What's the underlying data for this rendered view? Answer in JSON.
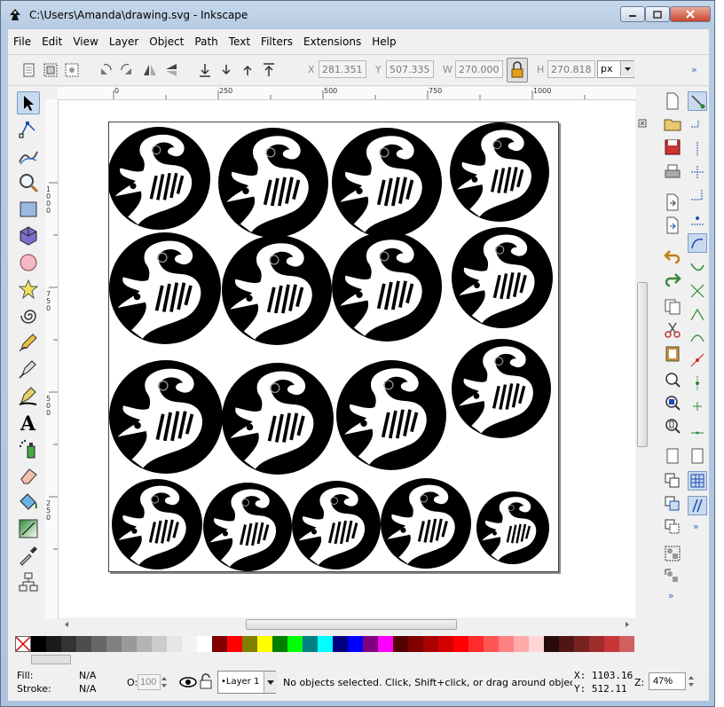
{
  "window": {
    "title": "C:\\Users\\Amanda\\drawing.svg - Inkscape"
  },
  "menu": [
    "File",
    "Edit",
    "View",
    "Layer",
    "Object",
    "Path",
    "Text",
    "Filters",
    "Extensions",
    "Help"
  ],
  "toolbar": {
    "x_label": "X",
    "x_value": "281.351",
    "y_label": "Y",
    "y_value": "507.335",
    "w_label": "W",
    "w_value": "270.000",
    "h_label": "H",
    "h_value": "270.818",
    "unit": "px",
    "overflow": "»"
  },
  "ruler": {
    "h_ticks": [
      "0",
      "250",
      "500",
      "750",
      "1000"
    ],
    "v_ticks": [
      "1000",
      "750",
      "500",
      "250"
    ]
  },
  "status": {
    "fill_label": "Fill:",
    "fill_value": "N/A",
    "stroke_label": "Stroke:",
    "stroke_value": "N/A",
    "opacity_label": "O:",
    "opacity_value": "100",
    "layer": "•Layer 1",
    "message": "No objects selected. Click, Shift+click, or drag around objects",
    "x_coord": "X: 1103.16",
    "y_coord": "Y:  512.11",
    "zoom_label": "Z:",
    "zoom_value": "47%"
  },
  "palette": [
    "#000000",
    "#1a1a1a",
    "#333333",
    "#4d4d4d",
    "#666666",
    "#808080",
    "#999999",
    "#b3b3b3",
    "#cccccc",
    "#e6e6e6",
    "#f2f2f2",
    "#ffffff",
    "#800000",
    "#ff0000",
    "#808000",
    "#ffff00",
    "#008000",
    "#00ff00",
    "#008080",
    "#00ffff",
    "#000080",
    "#0000ff",
    "#800080",
    "#ff00ff",
    "#550000",
    "#800000",
    "#aa0000",
    "#d40000",
    "#ff0000",
    "#ff2a2a",
    "#ff5555",
    "#ff8080",
    "#ffaaaa",
    "#ffd5d5",
    "#280b0b",
    "#501616",
    "#782121",
    "#a02c2c",
    "#c83737",
    "#d35f5f"
  ]
}
